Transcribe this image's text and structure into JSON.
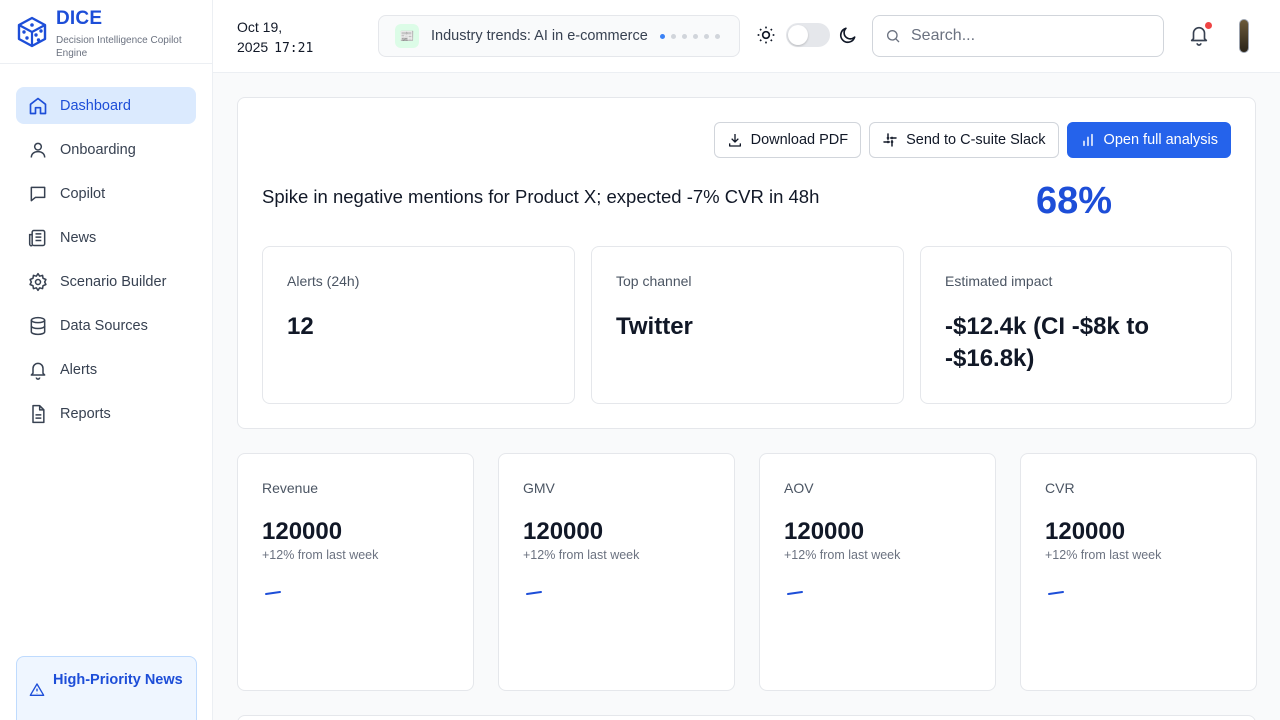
{
  "brand": {
    "name": "DICE",
    "subtitle": "Decision Intelligence Copilot Engine"
  },
  "nav": {
    "items": [
      {
        "label": "Dashboard",
        "icon": "home-icon",
        "active": true
      },
      {
        "label": "Onboarding",
        "icon": "user-icon"
      },
      {
        "label": "Copilot",
        "icon": "chat-icon"
      },
      {
        "label": "News",
        "icon": "newspaper-icon"
      },
      {
        "label": "Scenario Builder",
        "icon": "gear-icon"
      },
      {
        "label": "Data Sources",
        "icon": "database-icon"
      },
      {
        "label": "Alerts",
        "icon": "bell-icon"
      },
      {
        "label": "Reports",
        "icon": "file-icon"
      }
    ],
    "high_priority": "High-Priority News"
  },
  "header": {
    "date": "Oct 19,",
    "year": "2025",
    "time": "17:21",
    "ticker": {
      "text": "Industry trends: AI in e-commerce",
      "active_dot": 1,
      "dot_count": 6
    },
    "search_placeholder": "Search...",
    "notification_badge": true
  },
  "hero": {
    "actions": {
      "download": "Download PDF",
      "slack": "Send to C-suite Slack",
      "open": "Open full analysis"
    },
    "headline": "Spike in negative mentions for Product X; expected -7% CVR in 48h",
    "confidence": "68%",
    "stats": [
      {
        "label": "Alerts (24h)",
        "value": "12"
      },
      {
        "label": "Top channel",
        "value": "Twitter"
      },
      {
        "label": "Estimated impact",
        "value": "-$12.4k (CI -$8k to -$16.8k)"
      }
    ]
  },
  "kpis": [
    {
      "label": "Revenue",
      "value": "120000",
      "delta": "+12% from last week"
    },
    {
      "label": "GMV",
      "value": "120000",
      "delta": "+12% from last week"
    },
    {
      "label": "AOV",
      "value": "120000",
      "delta": "+12% from last week"
    },
    {
      "label": "CVR",
      "value": "120000",
      "delta": "+12% from last week"
    }
  ],
  "colors": {
    "accent": "#2563eb",
    "brand": "#1d4ed8",
    "active_bg": "#dbeafe",
    "badge": "#ef4444"
  }
}
